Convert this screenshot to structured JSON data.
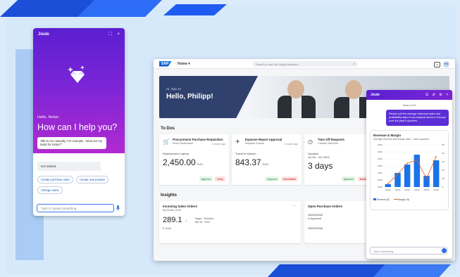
{
  "joule": {
    "title": "Joule",
    "expand_glyph": "⛶",
    "close_glyph": "×",
    "greeting": "Hello, Nolan.",
    "help_text": "How can I help you?",
    "hint": "Talk to me naturally. For example, \"what are my tasks for today?\"",
    "get_started": "Get started",
    "chips": [
      "Create purchase order",
      "Create new position",
      "Change name"
    ],
    "input_placeholder": "Type or speak something...",
    "icons": {
      "logo": "diamond-sparkle-icon",
      "mic": "microphone-icon"
    }
  },
  "sap": {
    "logo": "SAP",
    "home_label": "Home ▾",
    "search_placeholder": "Search or ask the Digital Assistant",
    "search_glyph": "⌕",
    "help_glyph": "?",
    "avatar_initials": "PM",
    "hero": {
      "subtitle": "Hi, Sep 24",
      "title": "Hello, Philipp!"
    },
    "todos_title": "To Dos",
    "todos": [
      {
        "icon": "🛒",
        "icon_name": "cart-icon",
        "title": "Procurement Purchase Requisition",
        "person": "Kevin Hudemann",
        "date": "1 month ago",
        "label": "Replacement Laptop",
        "value": "2,450.00",
        "unit": "EUR",
        "approve": "Approve",
        "deny": "Deny"
      },
      {
        "icon": "✈",
        "icon_name": "airplane-icon",
        "title": "Expense Report Approval",
        "person": "Stephan Klonus",
        "date": "1 month ago",
        "label": "Travel to Munich",
        "value": "843.37",
        "unit": "EUR",
        "approve": "Approve",
        "deny": "Send Back"
      },
      {
        "icon": "◷",
        "icon_name": "clock-icon",
        "title": "Time Off Requests",
        "person": "Carmen Sanchez",
        "date": "",
        "label": "Vacation\nJul 26 – 28, 2023",
        "value": "3 days",
        "unit": "",
        "approve": "Approve",
        "deny": "Decline"
      }
    ],
    "insights_title": "Insights",
    "insights": [
      {
        "title": "Incoming Sales Orders",
        "subtitle": "By Month, EUR",
        "value": "289.1",
        "arrow": "↑",
        "mini": "Target   Deviation\n289.18   9.8%",
        "unit": "K Units",
        "more": "···"
      },
      {
        "title": "Open Purchase Orders",
        "subtitle": "",
        "line1": "4500000045",
        "line2": "In Approval",
        "line3": "4500000046"
      }
    ]
  },
  "joule_panel": {
    "title": "Joule",
    "ctrl_glyphs": [
      "☰",
      "⇵",
      "⚙",
      "×"
    ],
    "time": "Today 10:00",
    "user_msg": "Please pull the average historical sales and profitability data of our physical stores in Europe over the past 6 quarters.",
    "card_title": "Revenue & Margin",
    "card_sub": "Average revenue and margin data - Last 6 quarters",
    "legend": [
      "Revenue ($)",
      "Margin (%)"
    ],
    "input_placeholder": "Type something..."
  },
  "chart_data": {
    "type": "bar",
    "title": "Revenue & Margin",
    "categories": [
      "Q1/22",
      "Q2/22",
      "Q3/22",
      "Q4/22",
      "Q1/23",
      "Q2/23"
    ],
    "series": [
      {
        "name": "Revenue ($)",
        "type": "bar",
        "values": [
          1020,
          1100,
          1160,
          1230,
          1080,
          1190
        ]
      },
      {
        "name": "Margin (%)",
        "type": "line",
        "values": [
          4,
          15,
          28,
          32,
          10,
          36
        ]
      }
    ],
    "y_left_ticks": [
      "1000",
      "1050",
      "1100",
      "1150",
      "1200",
      "1250",
      "1300"
    ],
    "y_right_ticks": [
      "0",
      "10",
      "20",
      "30",
      "40",
      "50"
    ],
    "ylim_left": [
      1000,
      1300
    ],
    "ylim_right": [
      0,
      50
    ],
    "colors": {
      "bar": "#1a73e8",
      "line": "#e85b1a"
    }
  }
}
